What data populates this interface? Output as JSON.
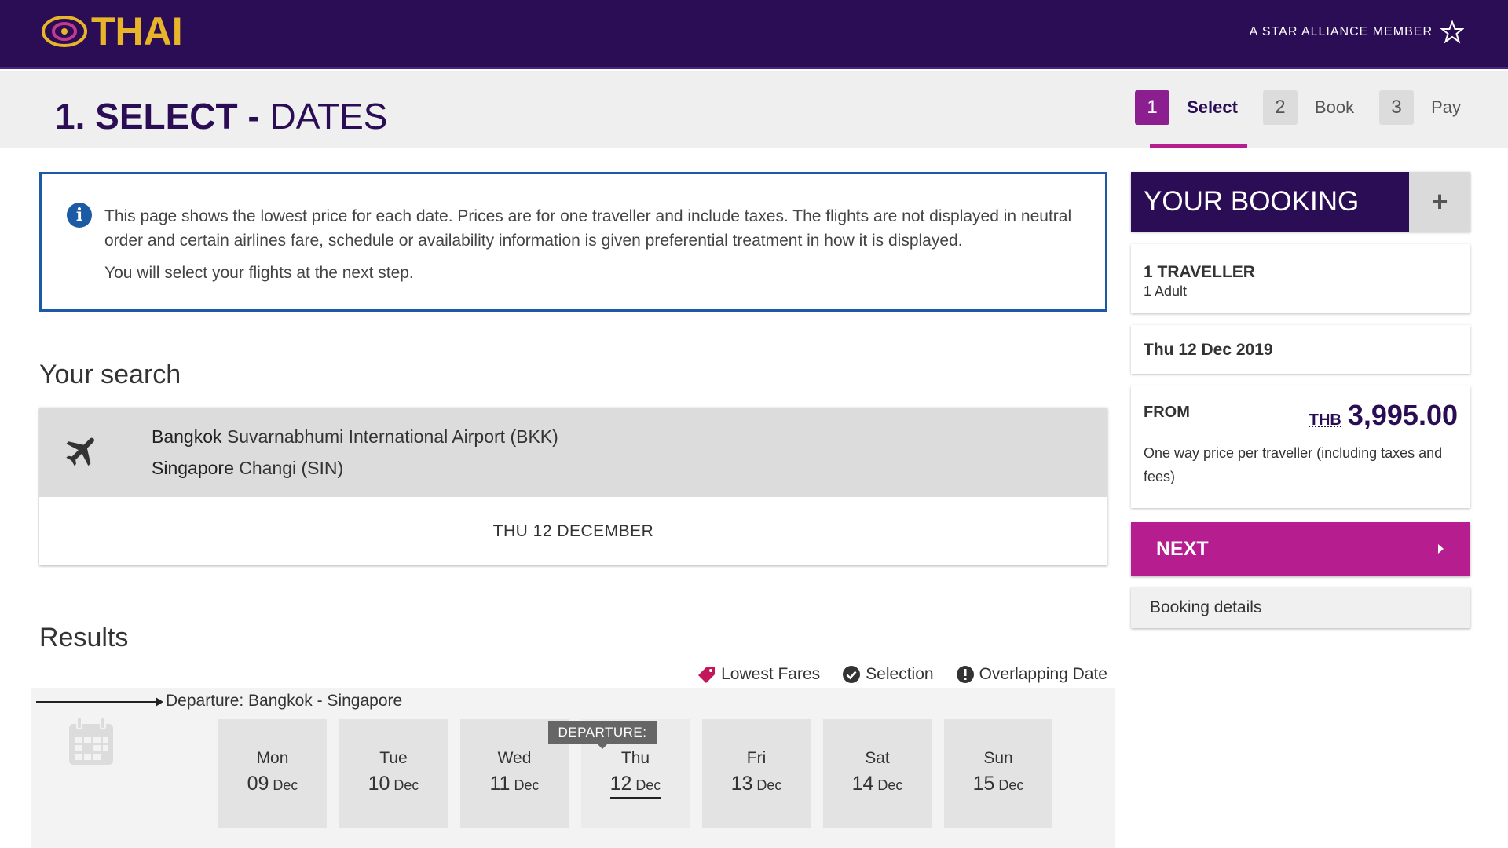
{
  "header": {
    "logo_text": "THAI",
    "alliance": "A STAR ALLIANCE MEMBER"
  },
  "page": {
    "title_bold": "1. SELECT",
    "title_sep": " - ",
    "title_rest": "DATES"
  },
  "steps": [
    {
      "num": "1",
      "label": "Select"
    },
    {
      "num": "2",
      "label": "Book"
    },
    {
      "num": "3",
      "label": "Pay"
    }
  ],
  "info": {
    "text": "This page shows the lowest price for each date. Prices are for one traveller and include taxes. The flights are not displayed in neutral order and certain airlines fare, schedule or availability information is given preferential treatment in how it is displayed.",
    "text2": "You will select your flights at the next step."
  },
  "search": {
    "title": "Your search",
    "origin_city": "Bangkok",
    "origin_airport": "Suvarnabhumi International Airport (BKK)",
    "dest_city": "Singapore",
    "dest_airport": "Changi (SIN)",
    "date": "THU 12 DECEMBER"
  },
  "results": {
    "title": "Results",
    "legend": {
      "lowest": "Lowest Fares",
      "selection": "Selection",
      "overlap": "Overlapping Date"
    },
    "departure_label": "Departure: Bangkok - Singapore",
    "departure_tag": "DEPARTURE:",
    "days": [
      {
        "name": "Mon",
        "num": "09",
        "month": "Dec"
      },
      {
        "name": "Tue",
        "num": "10",
        "month": "Dec"
      },
      {
        "name": "Wed",
        "num": "11",
        "month": "Dec"
      },
      {
        "name": "Thu",
        "num": "12",
        "month": "Dec"
      },
      {
        "name": "Fri",
        "num": "13",
        "month": "Dec"
      },
      {
        "name": "Sat",
        "num": "14",
        "month": "Dec"
      },
      {
        "name": "Sun",
        "num": "15",
        "month": "Dec"
      }
    ]
  },
  "booking": {
    "title": "YOUR BOOKING",
    "plus": "+",
    "travellers_title": "1 TRAVELLER",
    "travellers_sub": "1 Adult",
    "date": "Thu 12 Dec 2019",
    "from_label": "FROM",
    "currency": "THB",
    "price": "3,995.00",
    "price_note": "One way price per traveller (including taxes and fees)",
    "next_label": "NEXT",
    "details_label": "Booking details"
  },
  "colors": {
    "brand_purple": "#2b0d55",
    "accent_magenta": "#b61e8f",
    "info_blue": "#1c5aa6",
    "logo_gold": "#e8b52a"
  }
}
